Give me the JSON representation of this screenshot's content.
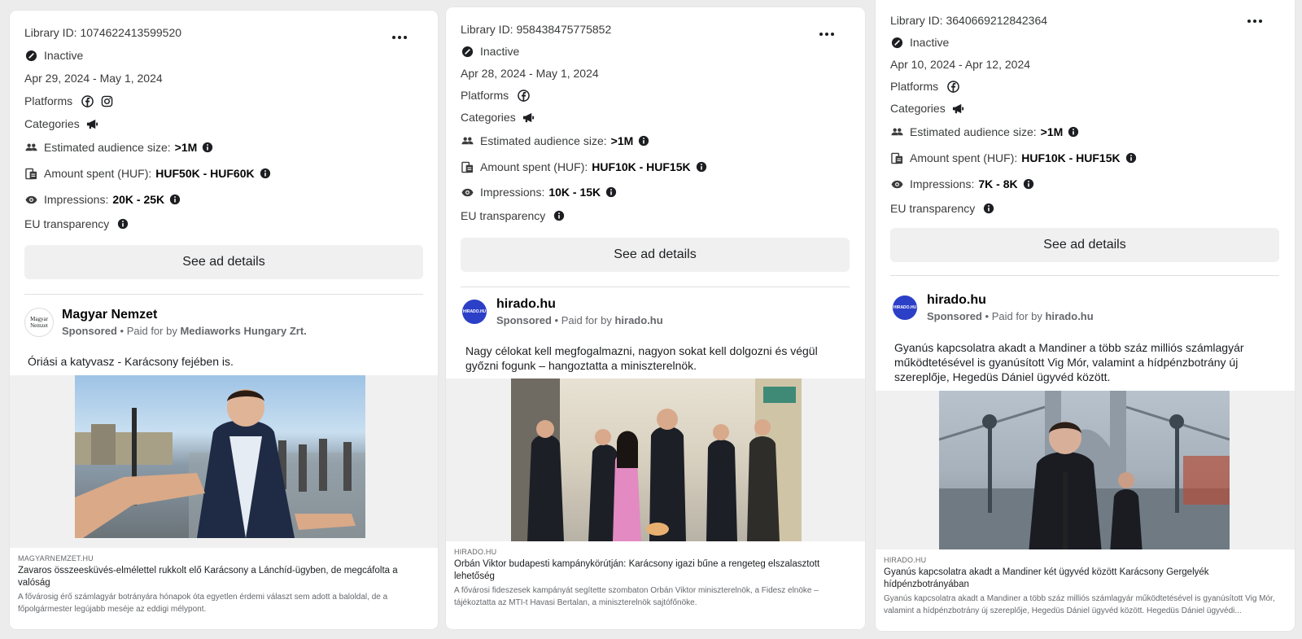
{
  "cards": [
    {
      "library_id": "Library ID: 1074622413599520",
      "status": "Inactive",
      "dates": "Apr 29, 2024 - May 1, 2024",
      "platforms_label": "Platforms",
      "platform_icons": [
        "facebook-icon",
        "instagram-icon"
      ],
      "categories_label": "Categories",
      "audience_label": "Estimated audience size:",
      "audience_value": ">1M",
      "spent_label": "Amount spent (HUF):",
      "spent_value": "HUF50K - HUF60K",
      "impressions_label": "Impressions:",
      "impressions_value": "20K - 25K",
      "eu_label": "EU transparency",
      "button": "See ad details",
      "advertiser": "Magyar Nemzet",
      "avatar_text": "Magyar Nemzet",
      "sponsored": "Sponsored",
      "paid_for_by": "• Paid for by",
      "payer": "Mediaworks Hungary Zrt.",
      "body": "Óriási a katyvasz - Karácsony fejében is.",
      "link_domain": "MAGYARNEMZET.HU",
      "link_title": "Zavaros összeesküvés-elmélettel rukkolt elő Karácsony a Lánchíd-ügyben, de megcáfolta a valóság",
      "link_desc": "A fővárosig érő számlagyár botrányára hónapok óta egyetlen érdemi választ sem adott a baloldal, de a főpolgármester legújabb meséje az eddigi mélypont."
    },
    {
      "library_id": "Library ID: 958438475775852",
      "status": "Inactive",
      "dates": "Apr 28, 2024 - May 1, 2024",
      "platforms_label": "Platforms",
      "platform_icons": [
        "facebook-icon"
      ],
      "categories_label": "Categories",
      "audience_label": "Estimated audience size:",
      "audience_value": ">1M",
      "spent_label": "Amount spent (HUF):",
      "spent_value": "HUF10K - HUF15K",
      "impressions_label": "Impressions:",
      "impressions_value": "10K - 15K",
      "eu_label": "EU transparency",
      "button": "See ad details",
      "advertiser": "hirado.hu",
      "avatar_text": "HIRADO.HU",
      "sponsored": "Sponsored",
      "paid_for_by": "• Paid for by",
      "payer": "hirado.hu",
      "body": "Nagy célokat kell megfogalmazni, nagyon sokat kell dolgozni és végül győzni fogunk – hangoztatta a miniszterelnök.",
      "link_domain": "HIRADO.HU",
      "link_title": "Orbán Viktor budapesti kampánykörútján: Karácsony igazi bűne a rengeteg elszalasztott lehetőség",
      "link_desc": "A fővárosi fideszesek kampányát segítette szombaton Orbán Viktor miniszterelnök, a Fidesz elnöke – tájékoztatta az MTI-t Havasi Bertalan, a miniszterelnök sajtófőnöke."
    },
    {
      "library_id": "Library ID: 3640669212842364",
      "status": "Inactive",
      "dates": "Apr 10, 2024 - Apr 12, 2024",
      "platforms_label": "Platforms",
      "platform_icons": [
        "facebook-icon"
      ],
      "categories_label": "Categories",
      "audience_label": "Estimated audience size:",
      "audience_value": ">1M",
      "spent_label": "Amount spent (HUF):",
      "spent_value": "HUF10K - HUF15K",
      "impressions_label": "Impressions:",
      "impressions_value": "7K - 8K",
      "eu_label": "EU transparency",
      "button": "See ad details",
      "advertiser": "hirado.hu",
      "avatar_text": "HIRADO.HU",
      "sponsored": "Sponsored",
      "paid_for_by": "• Paid for by",
      "payer": "hirado.hu",
      "body": "Gyanús kapcsolatra akadt a Mandiner a több száz milliós számlagyár működtetésével is gyanúsított Vig Mór, valamint a hídpénzbotrány új szereplője, Hegedüs Dániel ügyvéd között.",
      "link_domain": "HIRADO.HU",
      "link_title": "Gyanús kapcsolatra akadt a Mandiner két ügyvéd között Karácsony Gergelyék hídpénzbotrányában",
      "link_desc": "Gyanús kapcsolatra akadt a Mandiner a több száz milliós számlagyár működtetésével is gyanúsított Vig Mór, valamint a hídpénzbotrány új szereplője, Hegedüs Dániel ügyvéd között. Hegedüs Dániel ügyvédi..."
    }
  ],
  "colors": {
    "hirado_blue": "#2b3fc7",
    "button_bg": "#f0f0f0",
    "muted": "#65676b"
  }
}
